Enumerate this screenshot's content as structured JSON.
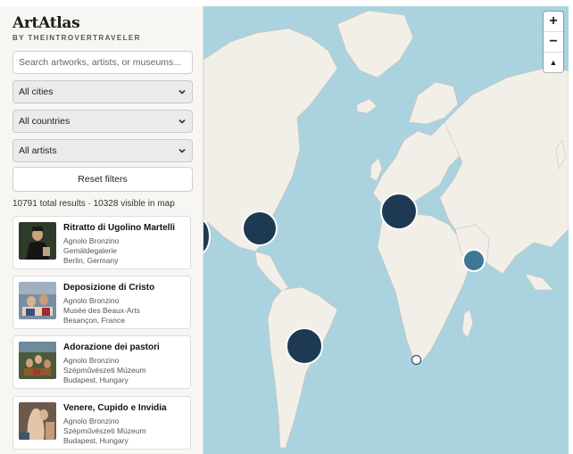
{
  "sidebar": {
    "logo": "ArtAtlas",
    "byline": "BY THEINTROVERTRAVELER",
    "search_placeholder": "Search artworks, artists, or museums...",
    "filters": {
      "city": "All cities",
      "country": "All countries",
      "artist": "All artists"
    },
    "reset_label": "Reset filters",
    "results_text": "10791 total results · 10328 visible in map",
    "cards": [
      {
        "title": "Ritratto di Ugolino Martelli",
        "artist": "Agnolo Bronzino",
        "museum": "Gemäldegalerie",
        "location": "Berlin, Germany"
      },
      {
        "title": "Deposizione di Cristo",
        "artist": "Agnolo Bronzino",
        "museum": "Musée des Beaux-Arts",
        "location": "Besançon, France"
      },
      {
        "title": "Adorazione dei pastori",
        "artist": "Agnolo Bronzino",
        "museum": "Szépművészeti Múzeum",
        "location": "Budapest, Hungary"
      },
      {
        "title": "Venere, Cupido e Invidia",
        "artist": "Agnolo Bronzino",
        "museum": "Szépművészeti Múzeum",
        "location": "Budapest, Hungary"
      }
    ]
  },
  "map": {
    "zoom_in": "+",
    "zoom_out": "−",
    "compass": "▲",
    "water_color": "#aad3df",
    "land_color": "#f2efe9",
    "cluster_color": "#1e3a52",
    "cluster_small_color": "#3f7894"
  }
}
